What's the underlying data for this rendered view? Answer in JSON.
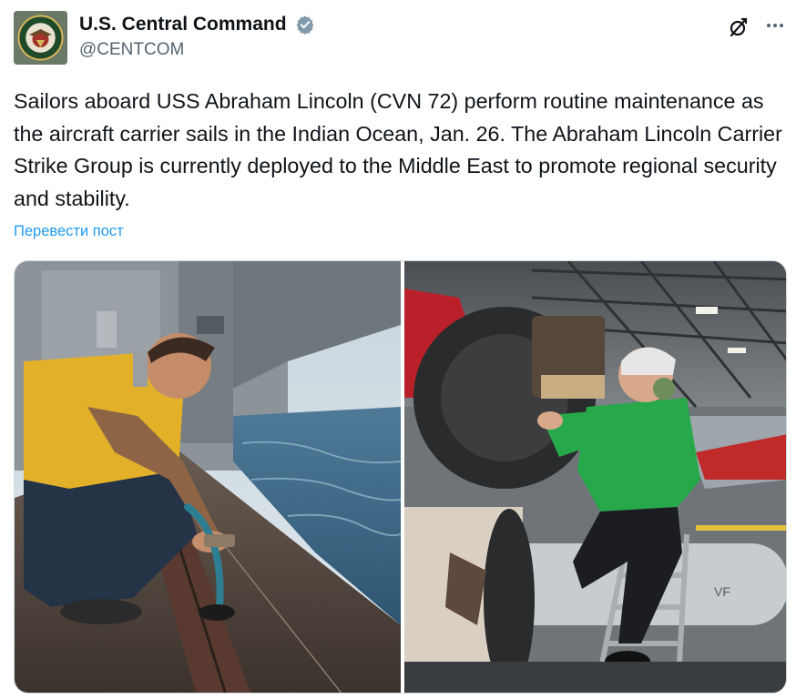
{
  "author": {
    "display_name": "U.S. Central Command",
    "handle": "@CENTCOM",
    "verified": true,
    "avatar_icon": "centcom-seal-icon"
  },
  "actions": {
    "grok_icon": "grok-icon",
    "more_icon": "more-options-icon"
  },
  "tweet": {
    "text": "Sailors aboard USS Abraham Lincoln (CVN 72) perform routine maintenance as the aircraft carrier sails in the Indian Ocean, Jan. 26. The Abraham Lincoln Carrier Strike Group is currently deployed to the Middle East to promote regional security and stability.",
    "translate_label": "Перевести пост"
  },
  "media": {
    "photos": [
      {
        "kind": "photo",
        "subject": "sailor-cleaning-catapult-track"
      },
      {
        "kind": "photo",
        "subject": "sailor-servicing-aircraft-landing-gear"
      }
    ],
    "jet_marking": "VF"
  },
  "colors": {
    "text": "#0f1419",
    "secondary": "#536471",
    "link": "#1d9bf0",
    "border": "#cfd9de"
  }
}
